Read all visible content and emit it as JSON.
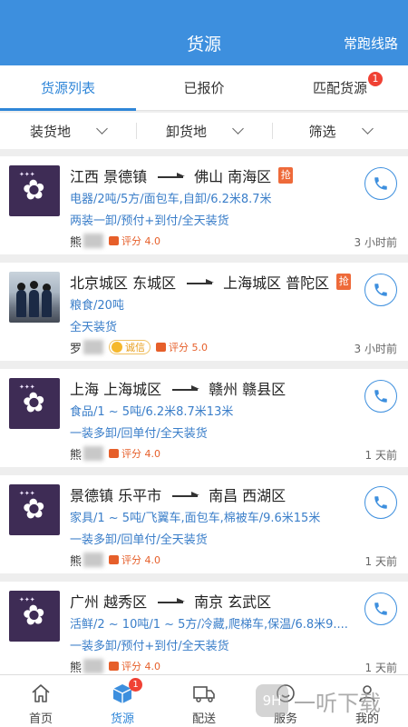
{
  "header": {
    "title": "货源",
    "right_action": "常跑线路"
  },
  "tabs": [
    {
      "label": "货源列表"
    },
    {
      "label": "已报价"
    },
    {
      "label": "匹配货源",
      "badge": "1"
    }
  ],
  "filters": [
    {
      "label": "装货地"
    },
    {
      "label": "卸货地"
    },
    {
      "label": "筛选"
    }
  ],
  "grab_label": "抢",
  "listings": [
    {
      "from": "江西 景德镇",
      "to": "佛山 南海区",
      "detail": "电器/2吨/5方/面包车,自卸/6.2米8.7米",
      "terms": "两装一卸/预付+到付/全天装货",
      "name": "熊",
      "rating": "评分 4.0",
      "time": "3 小时前"
    },
    {
      "from": "北京城区 东城区",
      "to": "上海城区 普陀区",
      "detail": "粮食/20吨",
      "terms": "全天装货",
      "name": "罗",
      "honesty": "诚信",
      "rating": "评分 5.0",
      "time": "3 小时前"
    },
    {
      "from": "上海 上海城区",
      "to": "赣州 赣县区",
      "detail": "食品/1 ~ 5吨/6.2米8.7米13米",
      "terms": "一装多卸/回单付/全天装货",
      "name": "熊",
      "rating": "评分 4.0",
      "time": "1 天前"
    },
    {
      "from": "景德镇 乐平市",
      "to": "南昌 西湖区",
      "detail": "家具/1 ~ 5吨/飞翼车,面包车,棉被车/9.6米15米",
      "terms": "一装多卸/回单付/全天装货",
      "name": "熊",
      "rating": "评分 4.0",
      "time": "1 天前"
    },
    {
      "from": "广州 越秀区",
      "to": "南京 玄武区",
      "detail": "活鲜/2 ~ 10吨/1 ~ 5方/冷藏,爬梯车,保温/6.8米9....",
      "terms": "一装多卸/预付+到付/全天装货",
      "name": "熊",
      "rating": "评分 4.0",
      "time": "1 天前"
    }
  ],
  "bottom_nav": [
    {
      "label": "首页",
      "icon": "home-icon"
    },
    {
      "label": "货源",
      "icon": "cube-icon",
      "badge": "1"
    },
    {
      "label": "配送",
      "icon": "truck-icon"
    },
    {
      "label": "服务",
      "icon": "smile-icon"
    },
    {
      "label": "我的",
      "icon": "user-icon"
    }
  ],
  "watermark": {
    "logo": "9H",
    "text": "一听下载"
  },
  "colors": {
    "primary": "#3d8fde",
    "accent": "#ee6a3a",
    "badge": "#f04134",
    "detail_text": "#3a7ec9"
  }
}
